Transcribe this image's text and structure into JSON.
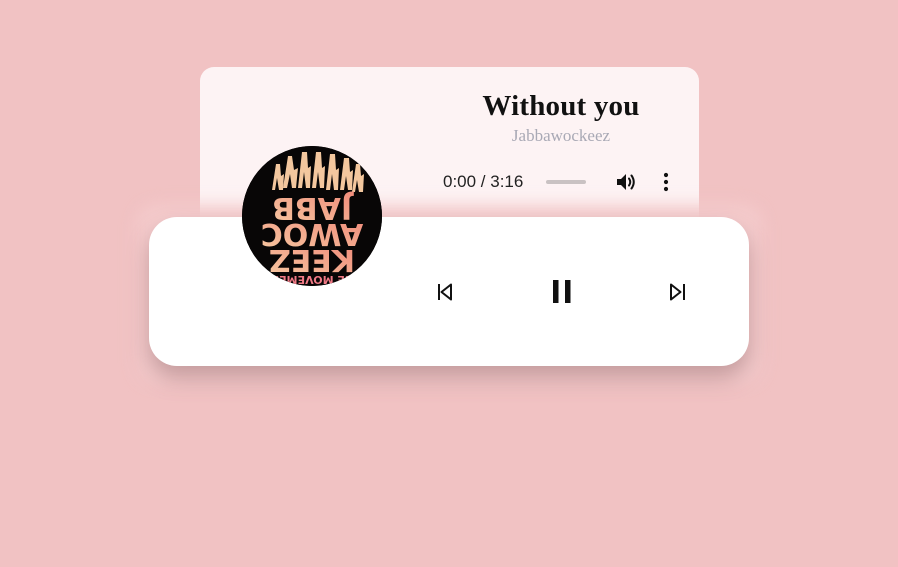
{
  "track": {
    "title": "Without you",
    "artist": "Jabbawockeez"
  },
  "audio": {
    "time": "0:00 / 3:16",
    "progress": 0
  },
  "cover_art": {
    "text_lines": [
      "JABB",
      "AWOC",
      "KEEZ",
      "THE MOVEMENT"
    ],
    "rotation": "upside-down"
  },
  "controls": {
    "prev_icon": "skip-previous-icon",
    "play_pause_icon": "pause-icon",
    "next_icon": "skip-next-icon",
    "volume_icon": "volume-icon",
    "more_icon": "more-vertical-icon"
  },
  "colors": {
    "background": "#f1c2c3",
    "card": "#fdf3f4",
    "panel": "#ffffff",
    "artist_text": "#a9a9b5"
  }
}
